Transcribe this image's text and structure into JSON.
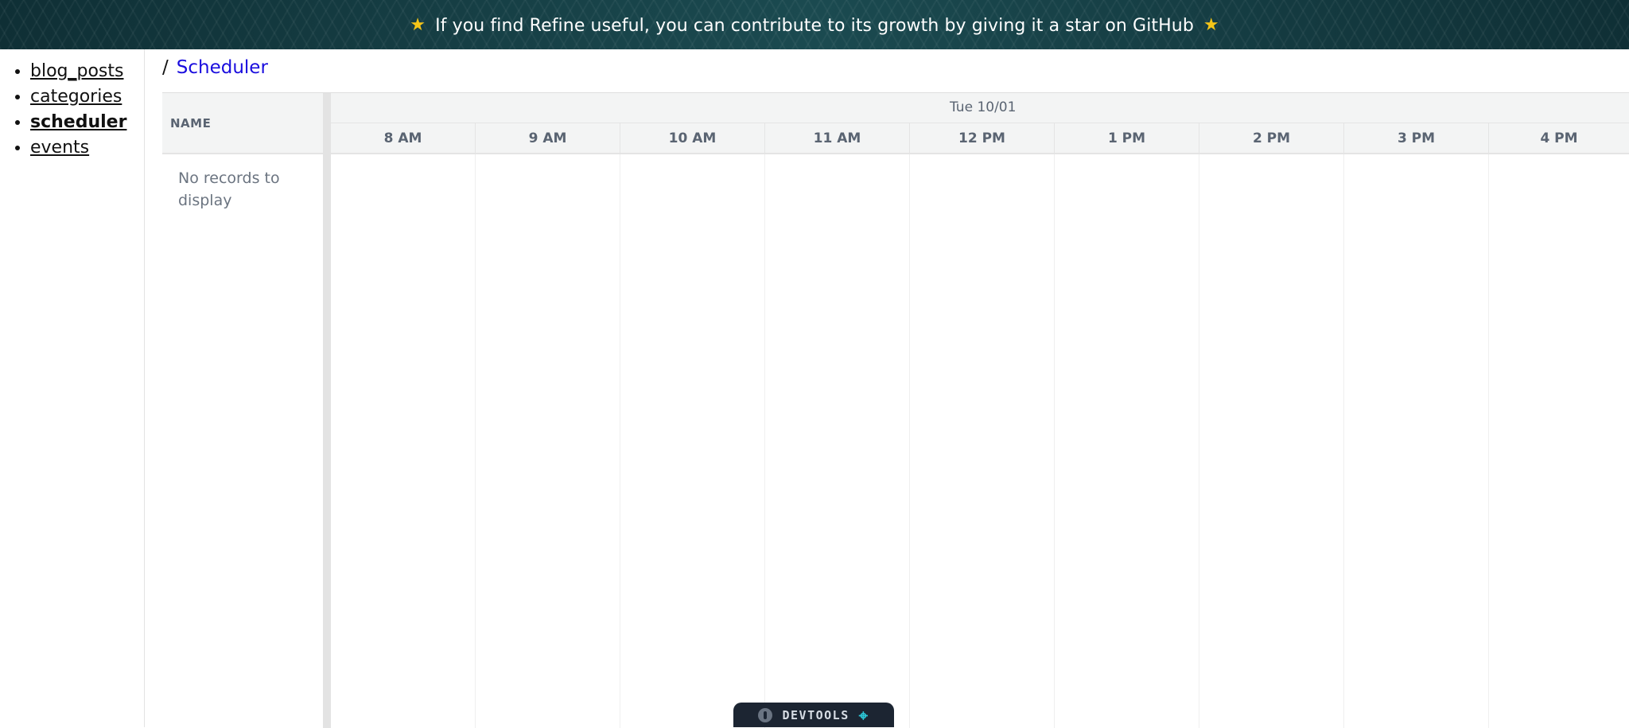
{
  "banner": {
    "text": "If you find Refine useful, you can contribute to its growth by giving it a star on GitHub",
    "star_icon": "star-icon"
  },
  "sidebar": {
    "items": [
      {
        "label": "blog_posts",
        "active": false
      },
      {
        "label": "categories",
        "active": false
      },
      {
        "label": "scheduler",
        "active": true
      },
      {
        "label": "events",
        "active": false
      }
    ]
  },
  "breadcrumb": {
    "separator": "/",
    "current": "Scheduler"
  },
  "scheduler": {
    "name_header": "NAME",
    "empty_text": "No records to display",
    "date": "Tue 10/01",
    "hours": [
      "8 AM",
      "9 AM",
      "10 AM",
      "11 AM",
      "12 PM",
      "1 PM",
      "2 PM",
      "3 PM",
      "4 PM"
    ]
  },
  "devtools": {
    "label": "DEVTOOLS"
  },
  "colors": {
    "link_current": "#1a0dde",
    "banner_bg": "#11353b",
    "devtools_bg": "#1c2532",
    "devtools_accent": "#2cc6d6"
  }
}
